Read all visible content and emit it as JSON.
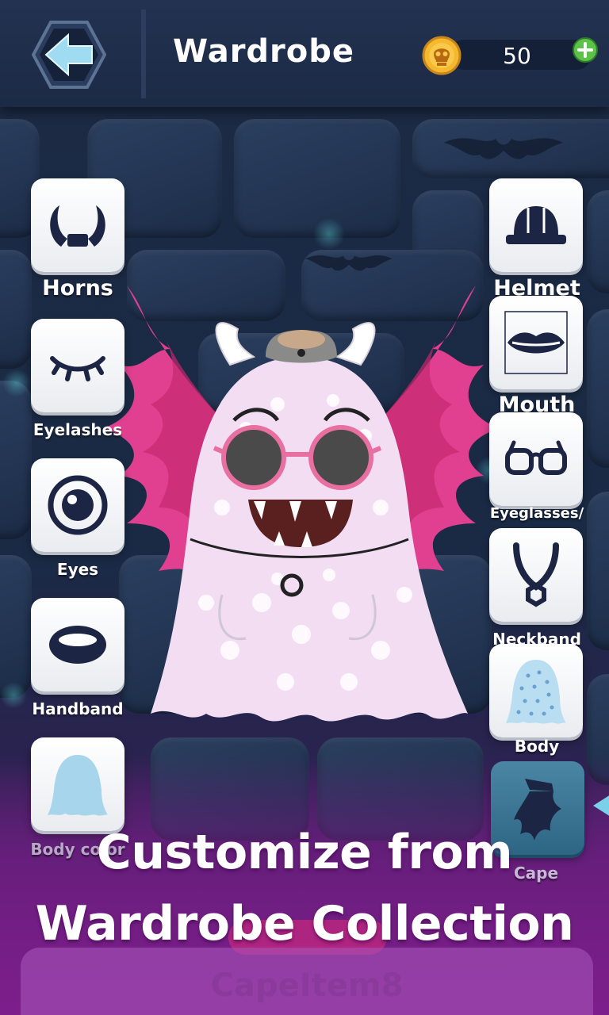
{
  "header": {
    "title": "Wardrobe",
    "coins": "50"
  },
  "left_categories": [
    {
      "label": "Horns"
    },
    {
      "label": "Eyelashes"
    },
    {
      "label": "Eyes"
    },
    {
      "label": "Handband"
    },
    {
      "label": "Body color"
    }
  ],
  "right_categories": [
    {
      "label": "Helmet"
    },
    {
      "label": "Mouth"
    },
    {
      "label": "Eyeglasses/"
    },
    {
      "label": "Neckband"
    },
    {
      "label": "Body"
    },
    {
      "label": "Cape",
      "selected": true
    }
  ],
  "promo": {
    "line1": "Customize from",
    "line2": "Wardrobe Collection"
  },
  "selected_item": {
    "name": "CapeItem8"
  },
  "colors": {
    "header_bg": "#1c2a45",
    "accent_pink": "#e0408f",
    "selected_category": "#2d6684",
    "coin_gold": "#f5b82e",
    "plus_green": "#5cc24a"
  }
}
